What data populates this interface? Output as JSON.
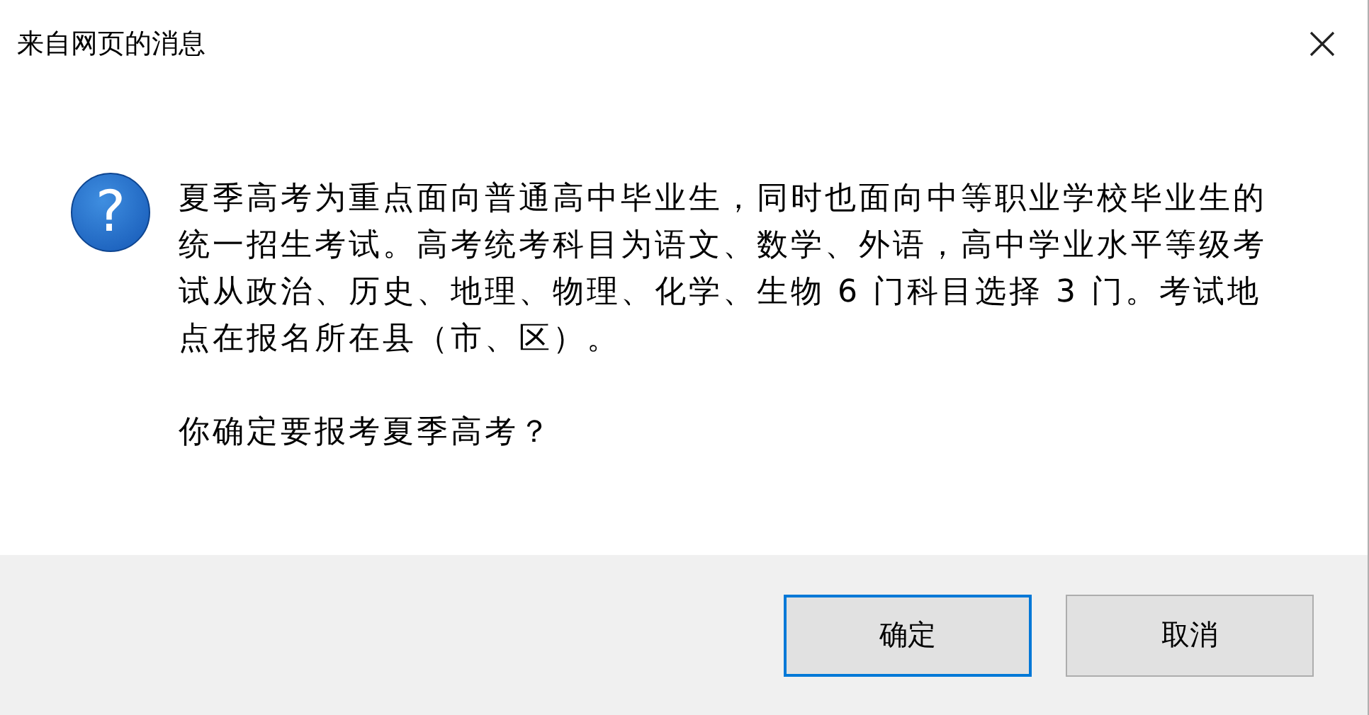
{
  "window": {
    "title": "来自网页的消息"
  },
  "message": {
    "icon": "?",
    "paragraphs": [
      "夏季高考为重点面向普通高中毕业生，同时也面向中等职业学校毕业生的统一招生考试。高考统考科目为语文、数学、外语，高中学业水平等级考试从政治、历史、地理、物理、化学、生物 6 门科目选择 3 门。考试地点在报名所在县（市、区）。",
      "你确定要报考夏季高考？"
    ]
  },
  "buttons": [
    {
      "label": "确定",
      "default": true
    },
    {
      "label": "取消",
      "default": false
    }
  ]
}
